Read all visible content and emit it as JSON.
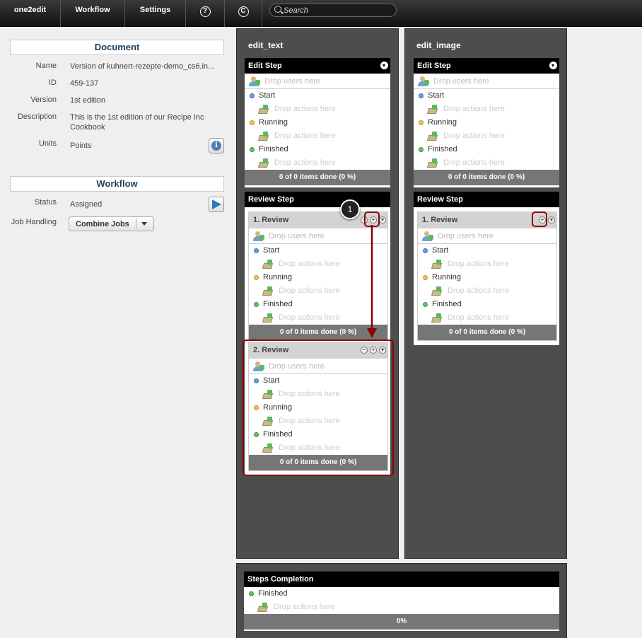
{
  "nav": {
    "app": "one2edit",
    "workflow": "Workflow",
    "settings": "Settings",
    "help_glyph": "?",
    "copyright_glyph": "C",
    "search_placeholder": "Search"
  },
  "document": {
    "heading": "Document",
    "fields": [
      {
        "label": "Name",
        "value": "Version of kuhnert-rezepte-demo_cs6.in..."
      },
      {
        "label": "ID",
        "value": "459-137"
      },
      {
        "label": "Version",
        "value": "1st edition"
      },
      {
        "label": "Description",
        "value": "This is the 1st edition of our Recipe Inc Cookbook"
      },
      {
        "label": "Units",
        "value": "Points"
      }
    ]
  },
  "workflow": {
    "heading": "Workflow",
    "status_label": "Status",
    "status_value": "Assigned",
    "job_label": "Job Handling",
    "job_value": "Combine Jobs"
  },
  "common": {
    "drop_users": "Drop users here",
    "drop_actions": "Drop actions here",
    "start": "Start",
    "running": "Running",
    "finished": "Finished",
    "progress": "0 of 0 items done (0 %)"
  },
  "columns": [
    {
      "title": "edit_text",
      "edit_step": "Edit Step",
      "review_step": "Review Step",
      "reviews": [
        "1. Review",
        "2. Review"
      ]
    },
    {
      "title": "edit_image",
      "edit_step": "Edit Step",
      "review_step": "Review Step",
      "reviews": [
        "1. Review"
      ]
    }
  ],
  "completion": {
    "heading": "Steps Completion",
    "finished": "Finished",
    "drop_actions": "Drop actions here",
    "progress": "0%"
  },
  "annotation": {
    "number": "1"
  },
  "colors": {
    "accent_red": "#8b0000",
    "heading_blue": "#1d3f5c",
    "column_bg": "#4d4d4d"
  }
}
